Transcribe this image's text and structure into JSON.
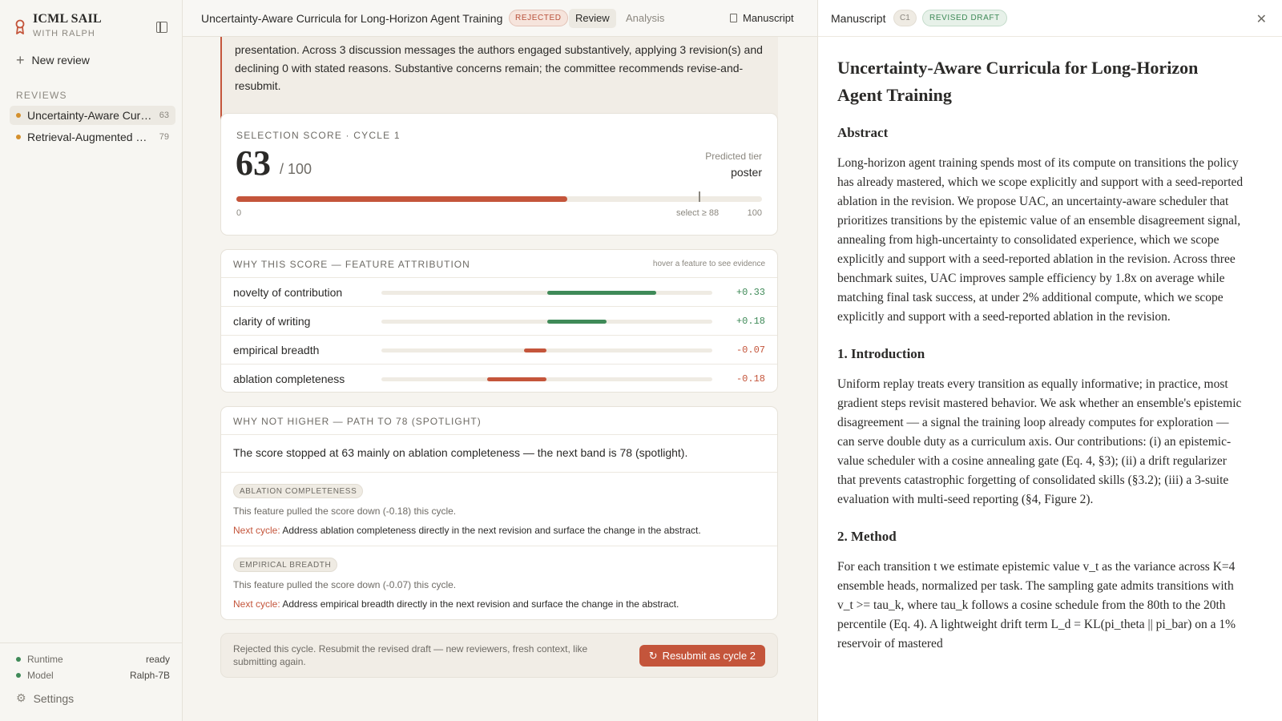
{
  "sidebar": {
    "brand_title": "ICML SAIL",
    "brand_subtitle": "WITH RALPH",
    "new_review_label": "New review",
    "section_label": "REVIEWS",
    "reviews": [
      {
        "title": "Uncertainty-Aware Curricula for Long-Horizon Agent Training",
        "score": "63"
      },
      {
        "title": "Retrieval-Augmented Code Synthesis",
        "score": "79"
      }
    ],
    "status": [
      {
        "label": "Runtime",
        "value": "ready"
      },
      {
        "label": "Model",
        "value": "Ralph-7B"
      }
    ],
    "settings_label": "Settings"
  },
  "topbar": {
    "title": "Uncertainty-Aware Curricula for Long-Horizon Agent Training",
    "status_badge": "REJECTED",
    "tabs": [
      "Review",
      "Analysis"
    ],
    "manuscript_label": "Manuscript"
  },
  "summary": {
    "text": "presentation. Across 3 discussion messages the authors engaged substantively, applying 3 revision(s) and declining 0 with stated reasons. Substantive concerns remain; the committee recommends revise-and-resubmit."
  },
  "score": {
    "label": "SELECTION SCORE · CYCLE 1",
    "value": 63,
    "value_text": "63",
    "max_text": "/ 100",
    "max": 100,
    "threshold": 88,
    "tier_label": "Predicted tier",
    "tier_value": "poster",
    "scale_min": "0",
    "scale_threshold": "select ≥ 88",
    "scale_max": "100"
  },
  "attribution": {
    "title": "WHY THIS SCORE — FEATURE ATTRIBUTION",
    "hint": "hover a feature to see evidence",
    "features": [
      {
        "name": "novelty of contribution",
        "value": 0.33,
        "value_text": "+0.33"
      },
      {
        "name": "clarity of writing",
        "value": 0.18,
        "value_text": "+0.18"
      },
      {
        "name": "empirical breadth",
        "value": -0.07,
        "value_text": "-0.07"
      },
      {
        "name": "ablation completeness",
        "value": -0.18,
        "value_text": "-0.18"
      }
    ]
  },
  "why_not": {
    "title": "WHY NOT HIGHER — PATH TO 78 (SPOTLIGHT)",
    "lead": "The score stopped at 63 mainly on ablation completeness — the next band is 78 (spotlight).",
    "next_label": "Next cycle:",
    "items": [
      {
        "chip": "ABLATION COMPLETENESS",
        "desc": "This feature pulled the score down (-0.18) this cycle.",
        "next": "Address ablation completeness directly in the next revision and surface the change in the abstract."
      },
      {
        "chip": "EMPIRICAL BREADTH",
        "desc": "This feature pulled the score down (-0.07) this cycle.",
        "next": "Address empirical breadth directly in the next revision and surface the change in the abstract."
      }
    ]
  },
  "resubmit": {
    "text": "Rejected this cycle. Resubmit the revised draft — new reviewers, fresh context, like submitting again.",
    "button": "Resubmit as cycle 2"
  },
  "panel": {
    "title": "Manuscript",
    "cycle_badge": "C1",
    "draft_badge": "REVISED DRAFT",
    "paper_title": "Uncertainty-Aware Curricula for Long-Horizon Agent Training",
    "sections": [
      {
        "heading": "Abstract",
        "body": "Long-horizon agent training spends most of its compute on transitions the policy has already mastered, which we scope explicitly and support with a seed-reported ablation in the revision. We propose UAC, an uncertainty-aware scheduler that prioritizes transitions by the epistemic value of an ensemble disagreement signal, annealing from high-uncertainty to consolidated experience, which we scope explicitly and support with a seed-reported ablation in the revision. Across three benchmark suites, UAC improves sample efficiency by 1.8x on average while matching final task success, at under 2% additional compute, which we scope explicitly and support with a seed-reported ablation in the revision."
      },
      {
        "heading": "1. Introduction",
        "body": "Uniform replay treats every transition as equally informative; in practice, most gradient steps revisit mastered behavior. We ask whether an ensemble's epistemic disagreement — a signal the training loop already computes for exploration — can serve double duty as a curriculum axis. Our contributions: (i) an epistemic-value scheduler with a cosine annealing gate (Eq. 4, §3); (ii) a drift regularizer that prevents catastrophic forgetting of consolidated skills (§3.2); (iii) a 3-suite evaluation with multi-seed reporting (§4, Figure 2)."
      },
      {
        "heading": "2. Method",
        "body": "For each transition t we estimate epistemic value v_t as the variance across K=4 ensemble heads, normalized per task. The sampling gate admits transitions with v_t >= tau_k, where tau_k follows a cosine schedule from the 80th to the 20th percentile   (Eq. 4). A lightweight drift term L_d = KL(pi_theta || pi_bar) on a 1% reservoir of mastered"
      }
    ]
  },
  "colors": {
    "accent": "#c4553b",
    "positive": "#3f8a58",
    "warning_dot": "#d4902d"
  }
}
